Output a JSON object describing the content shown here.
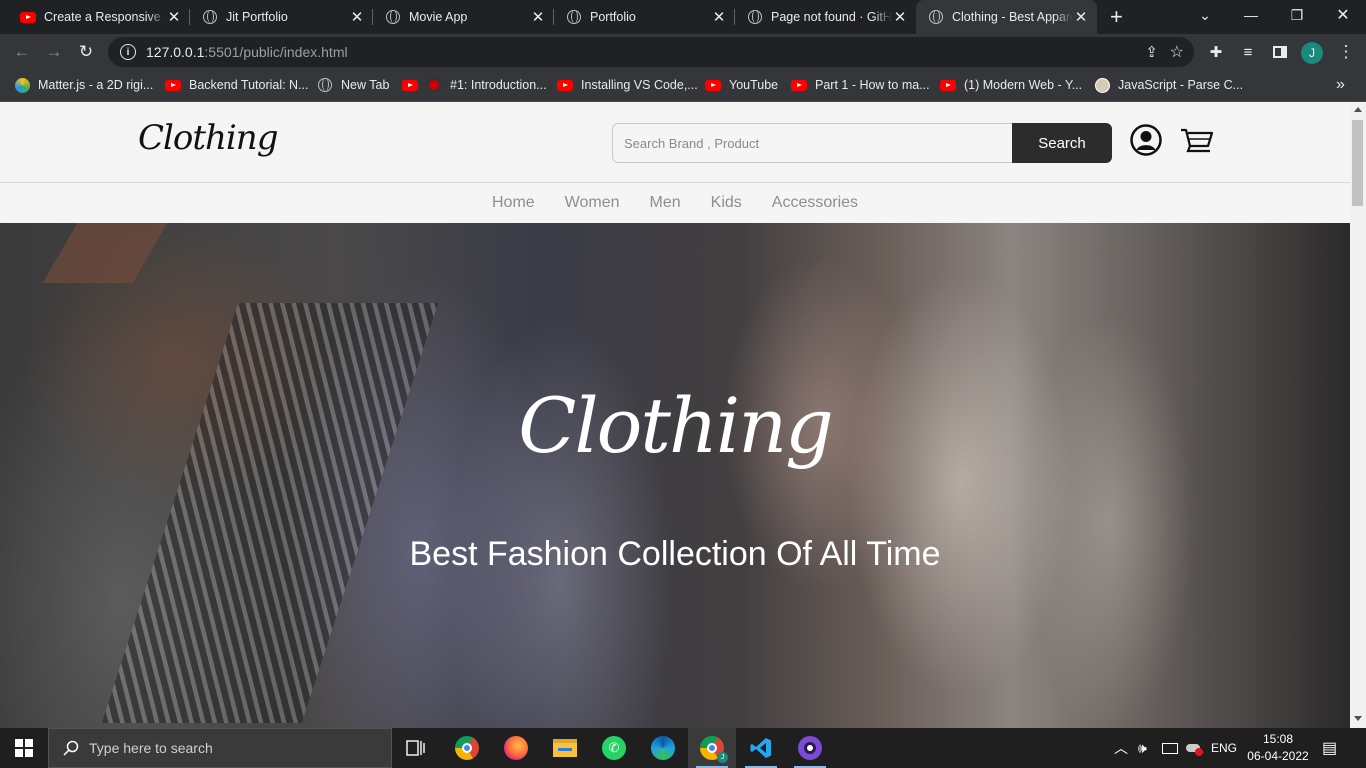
{
  "browser": {
    "tabs": [
      {
        "title": "Create a Responsive P",
        "icon": "youtube-icon",
        "active": false
      },
      {
        "title": "Jit Portfolio",
        "icon": "globe-icon",
        "active": false
      },
      {
        "title": "Movie App",
        "icon": "globe-icon",
        "active": false
      },
      {
        "title": "Portfolio",
        "icon": "globe-icon",
        "active": false
      },
      {
        "title": "Page not found · GitHu",
        "icon": "globe-icon",
        "active": false
      },
      {
        "title": "Clothing - Best Appare",
        "icon": "globe-icon",
        "active": true
      }
    ],
    "new_tab": "+",
    "address": {
      "host": "127.0.0.1",
      "rest": ":5501/public/index.html"
    },
    "profile_initial": "J",
    "bookmarks": [
      {
        "label": "Matter.js - a 2D rigi...",
        "icon": "matterjs-icon"
      },
      {
        "label": "Backend Tutorial: N...",
        "icon": "youtube-icon"
      },
      {
        "label": "New Tab",
        "icon": "globe-icon"
      },
      {
        "label": "#1: Introduction...",
        "icon": "youtube-icon"
      },
      {
        "label": "Installing VS Code,...",
        "icon": "youtube-icon"
      },
      {
        "label": "YouTube",
        "icon": "youtube-icon"
      },
      {
        "label": "Part 1 - How to ma...",
        "icon": "youtube-icon"
      },
      {
        "label": "(1) Modern Web - Y...",
        "icon": "youtube-icon"
      },
      {
        "label": "JavaScript - Parse C...",
        "icon": "avatar-icon"
      }
    ],
    "bookmarks_overflow": "»"
  },
  "site": {
    "logo": "Clothing",
    "search_placeholder": "Search Brand , Product",
    "search_button": "Search",
    "nav": [
      "Home",
      "Women",
      "Men",
      "Kids",
      "Accessories"
    ],
    "hero_logo": "Clothing",
    "hero_tagline": "Best Fashion Collection Of All Time"
  },
  "taskbar": {
    "search_placeholder": "Type here to search",
    "language": "ENG",
    "time": "15:08",
    "date": "06-04-2022"
  }
}
